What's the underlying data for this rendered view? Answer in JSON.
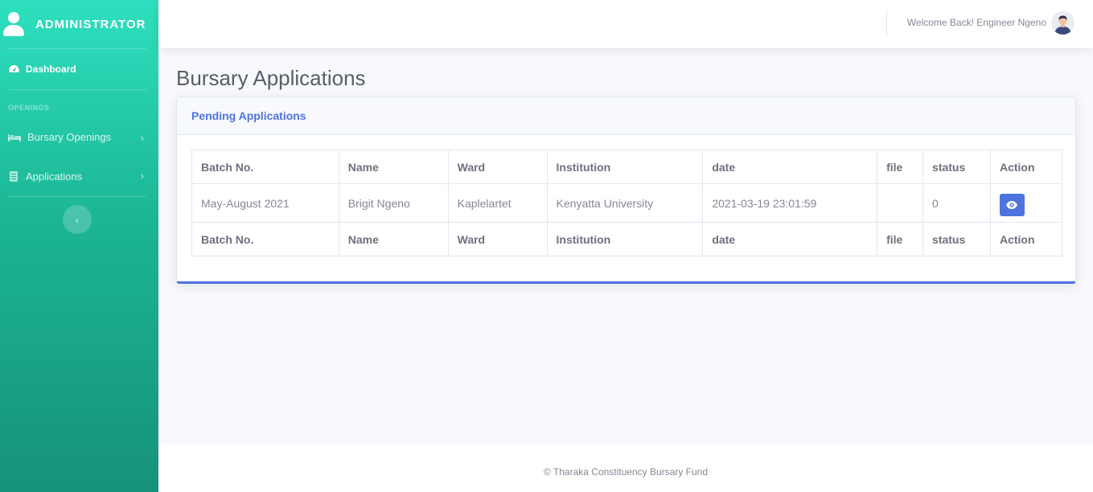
{
  "sidebar": {
    "brand": "ADMINISTRATOR",
    "dashboard_label": "Dashboard",
    "heading": "OPENINGS",
    "items": [
      {
        "label": "Bursary Openings"
      },
      {
        "label": "Applications"
      }
    ]
  },
  "topbar": {
    "welcome": "Welcome Back! Engineer Ngeno"
  },
  "page": {
    "title": "Bursary Applications"
  },
  "card": {
    "title": "Pending Applications"
  },
  "table": {
    "columns": [
      "Batch No.",
      "Name",
      "Ward",
      "Institution",
      "date",
      "file",
      "status",
      "Action"
    ],
    "rows": [
      {
        "batch": "May-August 2021",
        "name": "Brigit Ngeno",
        "ward": "Kaplelartet",
        "institution": "Kenyatta University",
        "date": "2021-03-19 23:01:59",
        "file": "",
        "status": "0"
      }
    ]
  },
  "footer": {
    "text": "© Tharaka Constituency Bursary Fund"
  },
  "colors": {
    "sidebar_top": "#2ee0bf",
    "sidebar_bottom": "#17927a",
    "primary": "#4e73df"
  },
  "icons": {
    "brand": "user-icon",
    "dashboard": "tachometer-icon",
    "openings": "bed-icon",
    "applications": "file-icon",
    "view": "eye-icon",
    "toggle": "chevron-left-icon"
  }
}
